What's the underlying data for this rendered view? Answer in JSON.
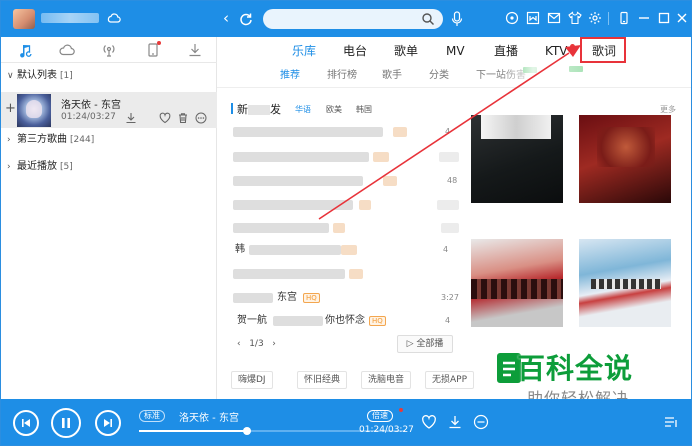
{
  "left_panel": {
    "groups": [
      {
        "name": "默认列表",
        "count": "[1]"
      },
      {
        "name": "第三方歌曲",
        "count": "[244]"
      },
      {
        "name": "最近播放",
        "count": "[5]"
      }
    ],
    "song": {
      "title": "洛天依 - 东宫",
      "time": "01:24/03:27"
    }
  },
  "top_tabs": [
    "乐库",
    "电台",
    "歌单",
    "MV",
    "直播",
    "KTV",
    "歌词"
  ],
  "sub_tabs": [
    "推荐",
    "排行榜",
    "歌手",
    "分类",
    "下一站伤害"
  ],
  "section": {
    "title": "新",
    "title_end": "发",
    "tabs": [
      "华语",
      "欧美",
      "韩国"
    ],
    "more": "更多"
  },
  "rows": [
    {
      "num": "4",
      "text": ""
    },
    {
      "num": "",
      "text": ""
    },
    {
      "num": "48",
      "text": ""
    },
    {
      "num": "",
      "text": ""
    },
    {
      "num": "",
      "text": ""
    },
    {
      "num": "4",
      "text": "韩"
    },
    {
      "num": "",
      "text": ""
    },
    {
      "num": "3:27",
      "text": "东宫"
    },
    {
      "num": "",
      "text": "贺一航"
    }
  ],
  "row_extras": {
    "row8_tag": "HQ",
    "row9_mid": "你也怀念",
    "row9_tag": "HQ",
    "row9_num": "4"
  },
  "pager": {
    "page": "1/3",
    "play_all": "全部播"
  },
  "categories": [
    "嗨爆DJ",
    "怀旧经典",
    "洗脑电音",
    "无损APP"
  ],
  "watermark": {
    "title": "百科全说",
    "subtitle": "助你轻松解决"
  },
  "player": {
    "quality": "标准",
    "now_playing": "洛天依 - 东宫",
    "speed": "倍速",
    "time": "01:24/03:27",
    "progress": 0.405
  },
  "colors": {
    "accent": "#1e8ee6",
    "highlight_box": "#e8333a",
    "watermark": "#0d9d3a"
  }
}
